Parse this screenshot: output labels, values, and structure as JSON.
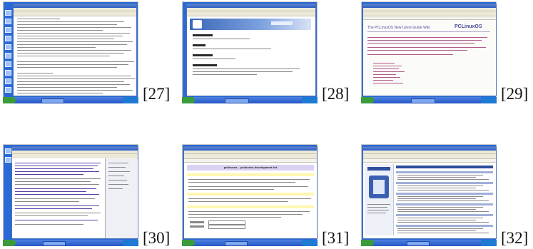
{
  "figure_labels": [
    "[27]",
    "[28]",
    "[29]",
    "[30]",
    "[31]",
    "[32]"
  ],
  "thumbnails": [
    {
      "desc_name": "text-document-screenshot"
    },
    {
      "desc_name": "man-page-screenshot"
    },
    {
      "desc_name": "pclinuxos-guide-screenshot",
      "heading": "The PCLinuxOS New Users Guide Wiki",
      "logo": "PCLinuxOS"
    },
    {
      "desc_name": "mail-client-screenshot"
    },
    {
      "desc_name": "mailing-list-page-screenshot",
      "heading": "pclinuxos – pclinuxos development list"
    },
    {
      "desc_name": "forum-page-screenshot"
    }
  ],
  "colors": {
    "desktop": "#2a63d4",
    "taskbar": "#2e62cc",
    "accent_purple": "#5a3fa8"
  }
}
